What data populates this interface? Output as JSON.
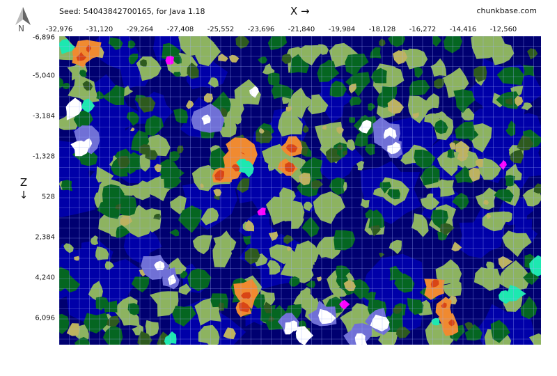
{
  "header": {
    "seed_text": "Seed: 54043842700165, for Java 1.18",
    "x_axis_title": "X →",
    "brand": "chunkbase.com"
  },
  "compass": {
    "label": "N",
    "icon": "north-arrow-icon"
  },
  "axes": {
    "z_axis_title": "Z",
    "z_axis_arrow": "↓",
    "x_ticks": [
      "-32,976",
      "-31,120",
      "-29,264",
      "-27,408",
      "-25,552",
      "-23,696",
      "-21,840",
      "-19,984",
      "-18,128",
      "-16,272",
      "-14,416",
      "-12,560"
    ],
    "z_ticks": [
      "-6,896",
      "-5,040",
      "-3,184",
      "-1,328",
      "528",
      "2,384",
      "4,240",
      "6,096"
    ]
  },
  "map": {
    "description": "biome map",
    "colors": {
      "deep_ocean": "#000070",
      "ocean": "#0000a8",
      "plains": "#8db360",
      "forest": "#056621",
      "dark_forest": "#2e5a1e",
      "savanna": "#bdb25f",
      "badlands": "#d94515",
      "badlands_plateau": "#f08a30",
      "snowy": "#ffffff",
      "frozen_ocean": "#7070d6",
      "mushroom": "#ff00ff",
      "warm_ocean": "#1de8b0",
      "grid": "#9fb0ff"
    }
  }
}
